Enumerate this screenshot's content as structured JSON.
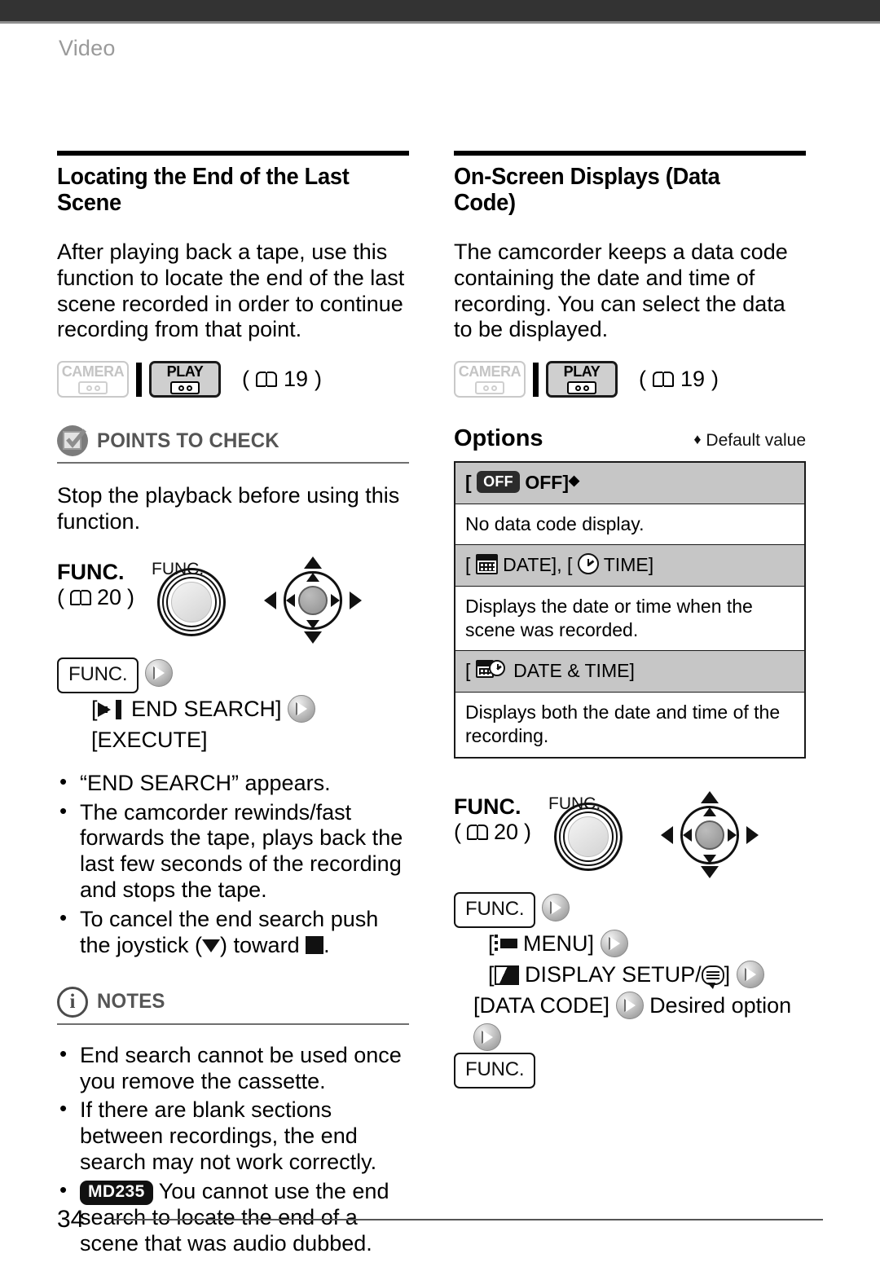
{
  "header": {
    "chapter": "Video"
  },
  "page": {
    "number": "34"
  },
  "left": {
    "section_title": "Locating the End of the Last Scene",
    "intro": "After playing back a tape, use this function to locate the end of the last scene recorded in order to continue recording from that point.",
    "modes": {
      "camera_label": "CAMERA",
      "play_label": "PLAY",
      "camera_active": false,
      "play_active": true,
      "page_ref": "19"
    },
    "points_to_check": {
      "title": "POINTS TO CHECK",
      "icon": "checkbox-check-icon",
      "text": "Stop the playback before using this function."
    },
    "func": {
      "label": "FUNC.",
      "page_ref": "20",
      "dial_caption": "FUNC."
    },
    "steps": {
      "key": "FUNC.",
      "end_search_icon": "end-search-icon",
      "end_search": "END SEARCH]",
      "open_bracket": "[",
      "execute": "[EXECUTE]"
    },
    "bullets": [
      "“END SEARCH” appears.",
      "The camcorder rewinds/fast forwards the tape, plays back the last few seconds of the recording and stops the tape."
    ],
    "cancel_bullet": {
      "before": "To cancel the end search push the joystick (",
      "middle": ") toward ",
      "after": "."
    },
    "notes": {
      "title": "NOTES",
      "icon": "info-circle-icon",
      "items": [
        {
          "badge": "",
          "text": "End search cannot be used once you remove the cassette."
        },
        {
          "badge": "",
          "text": "If there are blank sections between recordings, the end search may not work correctly."
        },
        {
          "badge": "MD235",
          "text": "You cannot use the end search to locate the end of a scene that was audio dubbed."
        }
      ]
    }
  },
  "right": {
    "section_title": "On-Screen Displays (Data Code)",
    "intro": "The camcorder keeps a data code containing the date and time of recording. You can select the data to be displayed.",
    "modes": {
      "camera_label": "CAMERA",
      "play_label": "PLAY",
      "camera_active": false,
      "play_active": true,
      "page_ref": "19"
    },
    "options": {
      "title": "Options",
      "legend": "Default value",
      "legend_marker": "♦",
      "rows": [
        {
          "option": "OFF]",
          "option_prefix": "[",
          "badge": "OFF",
          "icon": "off-badge-icon",
          "is_default": true,
          "description": "No data code display."
        },
        {
          "option": "DATE], [",
          "option_prefix": "[",
          "option_suffix": "TIME]",
          "icon": "calendar-icon",
          "icon2": "clock-icon",
          "is_default": false,
          "description": "Displays the date or time when the scene was recorded."
        },
        {
          "option": "DATE & TIME]",
          "option_prefix": "[",
          "icon": "calendar-clock-icon",
          "is_default": false,
          "description": "Displays both the date and time of the recording."
        }
      ]
    },
    "func": {
      "label": "FUNC.",
      "page_ref": "20",
      "dial_caption": "FUNC."
    },
    "steps": {
      "key_open": "FUNC.",
      "menu": "MENU]",
      "menu_prefix": "[",
      "display_setup": "DISPLAY SETUP/",
      "display_setup_prefix": "[",
      "display_setup_suffix": "]",
      "data_code": "[DATA CODE]",
      "desired_option": "Desired option",
      "key_close": "FUNC."
    }
  },
  "icons": {
    "book": "book-page-reference-icon",
    "arrow_button": "right-arrow-button-icon",
    "joystick": "joystick-icon",
    "func_dial": "func-dial-icon"
  }
}
